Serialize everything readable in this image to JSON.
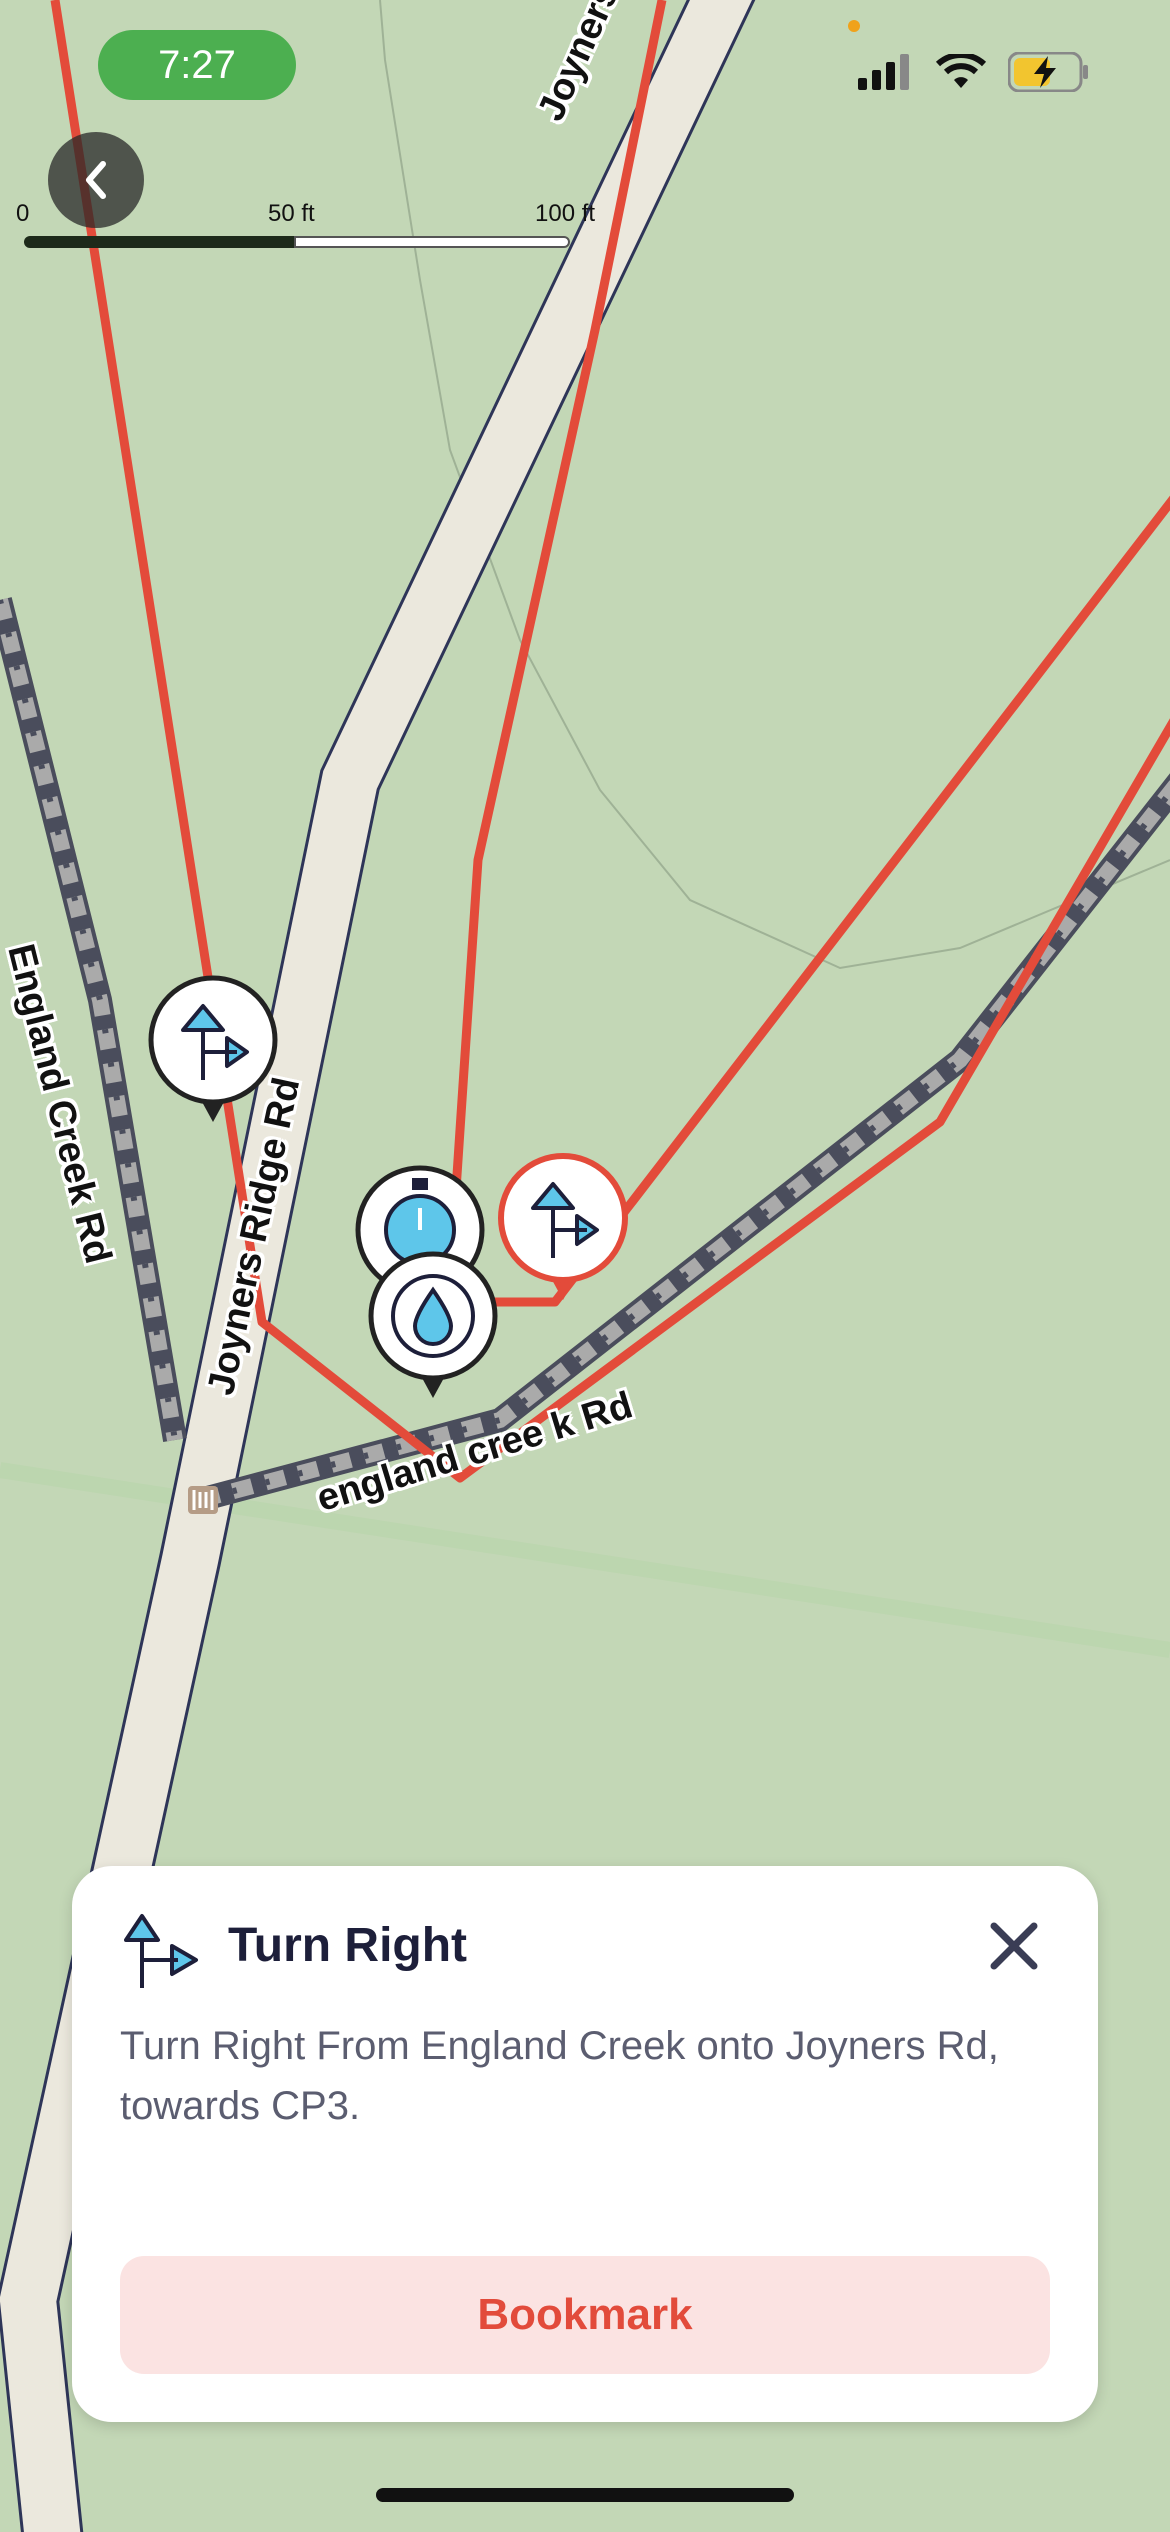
{
  "status_bar": {
    "time": "7:27",
    "icons": [
      "signal-icon",
      "wifi-icon",
      "battery-charging-icon"
    ]
  },
  "map": {
    "scale": {
      "labels": [
        "0",
        "50 ft",
        "100 ft"
      ]
    },
    "road_labels": {
      "joyners_ridge_top": "Joyners Ridge",
      "joyners_ridge_rd": "Joyners Ridge Rd",
      "england_creek_rd": "England Creek Rd",
      "england_creek_k_rd": "england cree k Rd"
    },
    "markers": [
      "turn-right-marker",
      "stopwatch-marker",
      "turn-right-marker-selected",
      "water-drop-marker",
      "trailhead-icon"
    ],
    "colors": {
      "background": "#c3d7b6",
      "route": "#e34b3a",
      "road": "#ebe8dd",
      "trail": "#4a4d5c"
    }
  },
  "card": {
    "icon": "turn-right-icon",
    "title": "Turn Right",
    "description": "Turn Right From England Creek onto Joyners Rd, towards CP3.",
    "bookmark_label": "Bookmark",
    "close_icon": "close-icon"
  }
}
